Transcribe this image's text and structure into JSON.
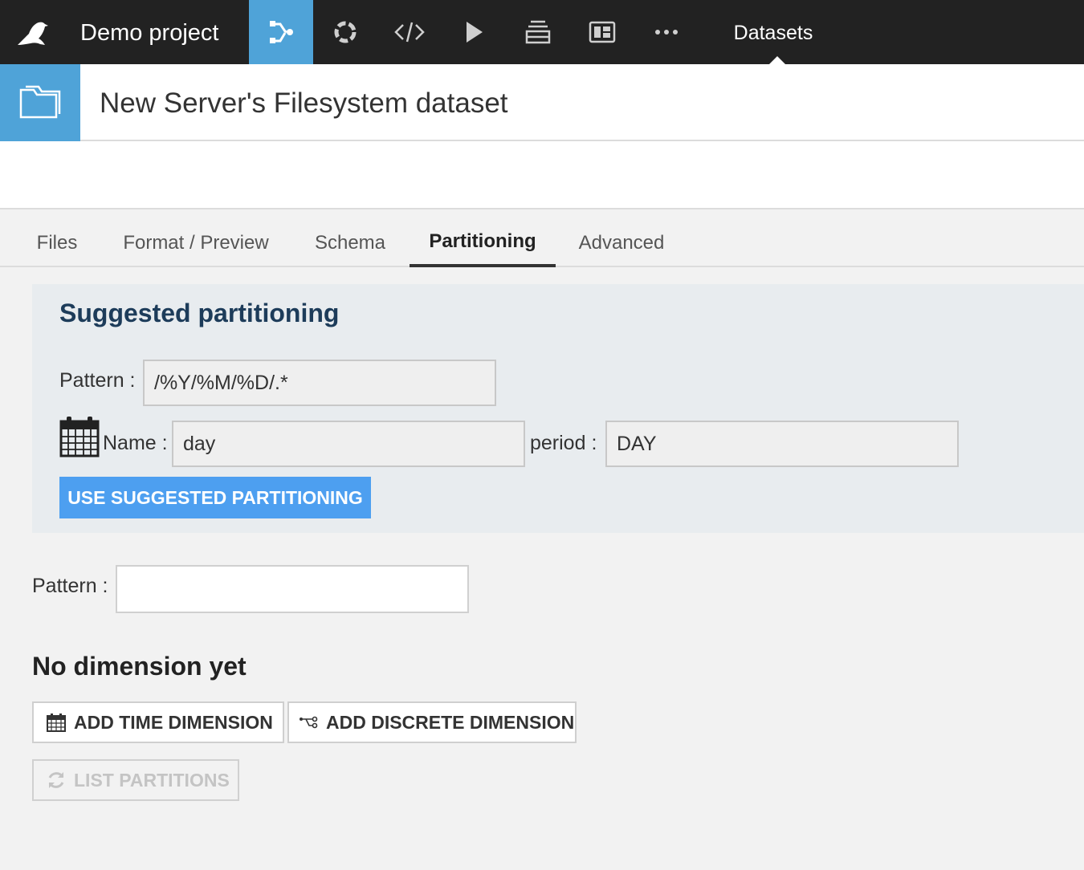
{
  "topbar": {
    "project_title": "Demo project",
    "section_label": "Datasets",
    "icons": [
      "flow-icon",
      "jobs-icon",
      "code-icon",
      "run-icon",
      "datasets-stack-icon",
      "dashboard-icon",
      "more-icon"
    ]
  },
  "header": {
    "title": "New Server's Filesystem dataset"
  },
  "tabs": [
    "Files",
    "Format / Preview",
    "Schema",
    "Partitioning",
    "Advanced"
  ],
  "active_tab": "Partitioning",
  "suggested": {
    "title": "Suggested partitioning",
    "pattern_label": "Pattern :",
    "pattern_value": "/%Y/%M/%D/.*",
    "name_label": "Name :",
    "name_value": "day",
    "period_label": "period :",
    "period_value": "DAY",
    "button_label": "USE SUGGESTED PARTITIONING"
  },
  "partitioning": {
    "pattern_label": "Pattern :",
    "pattern_value": "",
    "no_dimension_text": "No dimension yet",
    "add_time_label": "ADD TIME DIMENSION",
    "add_discrete_label": "ADD DISCRETE DIMENSION",
    "list_partitions_label": "LIST PARTITIONS"
  },
  "colors": {
    "accent": "#4fa3d8",
    "primary_button": "#4d9ff0",
    "topbar": "#222222"
  }
}
